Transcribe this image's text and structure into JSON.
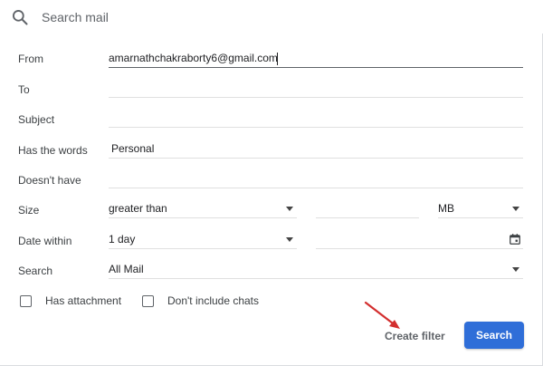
{
  "search": {
    "placeholder": "Search mail"
  },
  "labels": {
    "from": "From",
    "to": "To",
    "subject": "Subject",
    "has_words": "Has the words",
    "doesnt_have": "Doesn't have",
    "size": "Size",
    "date_within": "Date within",
    "search": "Search"
  },
  "fields": {
    "from": "amarnathchakraborty6@gmail.com",
    "to": "",
    "subject": "",
    "has_words": "Personal",
    "doesnt_have": "",
    "size_operator": "greater than",
    "size_value": "",
    "size_unit": "MB",
    "date_within": "1 day",
    "date_value": "",
    "search_scope": "All Mail"
  },
  "checkboxes": {
    "has_attachment": "Has attachment",
    "no_chats": "Don't include chats"
  },
  "buttons": {
    "create_filter": "Create filter",
    "search": "Search"
  },
  "colors": {
    "primary": "#2f6ed8",
    "annotation_arrow": "#d32f2f"
  },
  "icons": {
    "search": "search-icon",
    "dropdown": "caret-down-icon",
    "calendar": "calendar-icon",
    "annotation": "red-arrow"
  }
}
